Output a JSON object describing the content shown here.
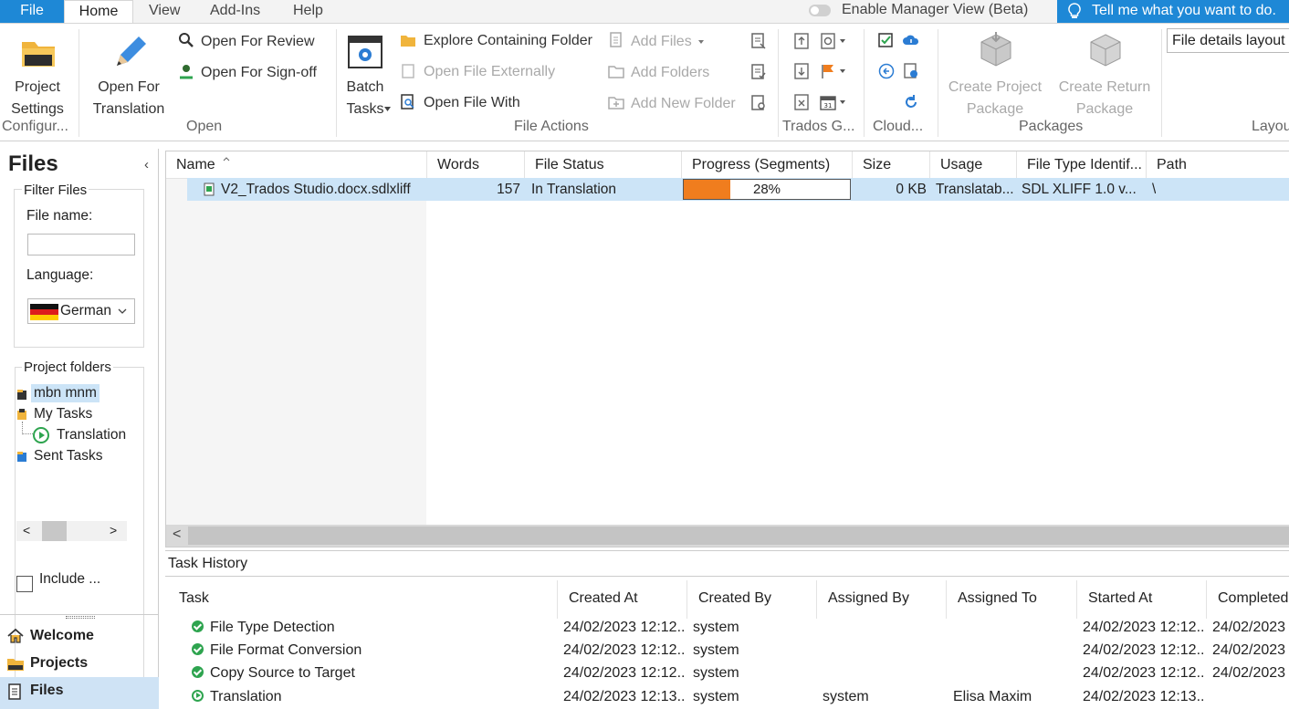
{
  "tabs": {
    "file": "File",
    "home": "Home",
    "view": "View",
    "addins": "Add-Ins",
    "help": "Help"
  },
  "manager_view": "Enable Manager View (Beta)",
  "tell_me": "Tell me what you want to do.",
  "ribbon": {
    "project_settings": [
      "Project",
      "Settings"
    ],
    "configure_group": "Configur...",
    "open_for_translation": [
      "Open For",
      "Translation"
    ],
    "open_for_review": "Open For Review",
    "open_for_signoff": "Open For Sign-off",
    "open_group": "Open",
    "batch_tasks": [
      "Batch",
      "Tasks"
    ],
    "explore_folder": "Explore Containing Folder",
    "open_externally": "Open File Externally",
    "open_file_with": "Open File With",
    "add_files": "Add Files",
    "add_folders": "Add Folders",
    "add_new_folder": "Add New Folder",
    "file_actions_group": "File Actions",
    "trados_group": "Trados G...",
    "cloud_group": "Cloud...",
    "create_project_package": [
      "Create Project",
      "Package"
    ],
    "create_return_package": [
      "Create Return",
      "Package"
    ],
    "packages_group": "Packages",
    "layout_value": "File details layout",
    "layout_group": "Layou"
  },
  "left": {
    "title": "Files",
    "filter_files": "Filter Files",
    "file_name_label": "File name:",
    "file_name_value": "",
    "language_label": "Language:",
    "language_value": "German",
    "project_folders": "Project folders",
    "folders": {
      "mbn": "mbn mnm",
      "my_tasks": "My Tasks",
      "translation": "Translation",
      "sent_tasks": "Sent Tasks"
    },
    "include": "Include ...",
    "nav": {
      "welcome": "Welcome",
      "projects": "Projects",
      "files": "Files"
    }
  },
  "grid": {
    "headers": {
      "name": "Name",
      "words": "Words",
      "status": "File Status",
      "progress": "Progress (Segments)",
      "size": "Size",
      "usage": "Usage",
      "filetype": "File Type Identif...",
      "path": "Path"
    },
    "row": {
      "name": "V2_Trados Studio.docx.sdlxliff",
      "words": "157",
      "status": "In Translation",
      "progress_pct": 28,
      "progress_label": "28%",
      "size": "0 KB",
      "usage": "Translatab...",
      "filetype": "SDL XLIFF 1.0 v...",
      "path": "\\"
    }
  },
  "task_history": {
    "title": "Task History",
    "headers": {
      "task": "Task",
      "created_at": "Created At",
      "created_by": "Created By",
      "assigned_by": "Assigned By",
      "assigned_to": "Assigned To",
      "started_at": "Started At",
      "completed": "Completed"
    },
    "rows": [
      {
        "task": "File Type Detection",
        "created_at": "24/02/2023 12:12...",
        "created_by": "system",
        "assigned_by": "",
        "assigned_to": "",
        "started_at": "24/02/2023 12:12...",
        "completed": "24/02/2023"
      },
      {
        "task": "File Format Conversion",
        "created_at": "24/02/2023 12:12...",
        "created_by": "system",
        "assigned_by": "",
        "assigned_to": "",
        "started_at": "24/02/2023 12:12...",
        "completed": "24/02/2023"
      },
      {
        "task": "Copy Source to Target",
        "created_at": "24/02/2023 12:12...",
        "created_by": "system",
        "assigned_by": "",
        "assigned_to": "",
        "started_at": "24/02/2023 12:12...",
        "completed": "24/02/2023"
      },
      {
        "task": "Translation",
        "created_at": "24/02/2023 12:13...",
        "created_by": "system",
        "assigned_by": "system",
        "assigned_to": "Elisa Maxim",
        "started_at": "24/02/2023 12:13...",
        "completed": ""
      }
    ]
  },
  "colors": {
    "accent": "#1e88d6",
    "selection": "#cce4f7",
    "progress": "#f07d1e",
    "nav_selected": "#cfe3f5"
  }
}
